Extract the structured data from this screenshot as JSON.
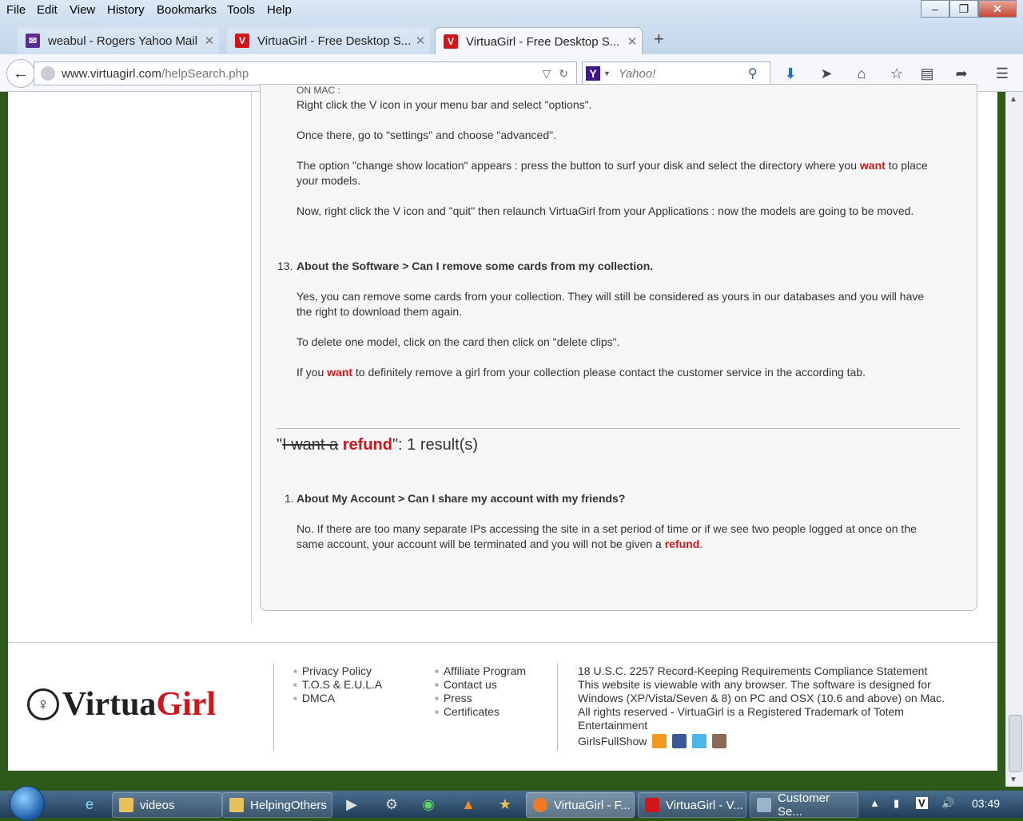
{
  "menubar": {
    "items": [
      "File",
      "Edit",
      "View",
      "History",
      "Bookmarks",
      "Tools",
      "Help"
    ]
  },
  "tabs": [
    {
      "title": "weabul - Rogers Yahoo Mail",
      "favicon": "yahoo-mail-icon",
      "active": false
    },
    {
      "title": "VirtuaGirl - Free Desktop S...",
      "favicon": "virtuagirl-icon",
      "active": false
    },
    {
      "title": "VirtuaGirl - Free Desktop S...",
      "favicon": "virtuagirl-icon",
      "active": true
    }
  ],
  "navbar": {
    "url_domain": "www.virtuagirl.com",
    "url_path": "/helpSearch.php",
    "search_placeholder": "Yahoo!"
  },
  "content": {
    "top_fragment": "ON MAC :",
    "mac_steps": [
      "Right click the V icon in your menu bar and select \"options\".",
      "Once there, go to \"settings\" and choose \"advanced\".",
      "The option \"change show location\" appears : press the button to surf your disk and select the directory where you",
      "to place",
      "your models.",
      "Now, right click the V icon and \"quit\" then relaunch VirtuaGirl from your Applications : now the models are going to be moved."
    ],
    "keyword_want": "want",
    "item13": {
      "number": "13.",
      "title": "About the Software > Can I remove some cards from my collection.",
      "p1_line1": "Yes, you can remove some cards from your collection. They will still be considered as yours in our databases and you will have",
      "p1_line2": "the right to download them again.",
      "p2": "To delete one model, click on the card then click on \"delete clips\".",
      "p3_pre": "If you",
      "p3_post": "to definitely remove a girl from your collection please contact the customer service in the according tab."
    },
    "results_heading": {
      "open_quote": "\"",
      "strike_text": "I want a",
      "keyword": "refund",
      "suffix": "\": 1 result(s)"
    },
    "item1": {
      "number": "1.",
      "title": "About My Account > Can I share my account with my friends?",
      "line1": "No. If there are too many separate IPs accessing the site in a set period of time or if we see two people logged at once on the",
      "line2_pre": "same account, your account will be terminated and you will not be given a",
      "keyword": "refund",
      "line2_post": "."
    }
  },
  "footer": {
    "logo_prefix": "Virtua",
    "logo_suffix": "Girl",
    "links_col1": [
      "Privacy Policy",
      "T.O.S & E.U.L.A",
      "DMCA"
    ],
    "links_col2": [
      "Affiliate Program",
      "Contact us",
      "Press",
      "Certificates"
    ],
    "legal_lines": [
      "18 U.S.C. 2257 Record-Keeping Requirements Compliance Statement",
      "This website is viewable with any browser. The software is designed for",
      "Windows (XP/Vista/Seven & 8) on PC and OSX (10.6 and above) on Mac.",
      "All rights reserved - VirtuaGirl is a Registered Trademark of Totem",
      "Entertainment"
    ],
    "girlsfullshow": "GirlsFullShow"
  },
  "taskbar": {
    "buttons": [
      "videos",
      "HelpingOthers",
      "VirtuaGirl - F...",
      "VirtuaGirl - V...",
      "Customer Se..."
    ],
    "clock": "03:49"
  },
  "colors": {
    "keyword": "#d1161b",
    "taskbar": "#203d58",
    "chrome": "#cfdff0"
  }
}
